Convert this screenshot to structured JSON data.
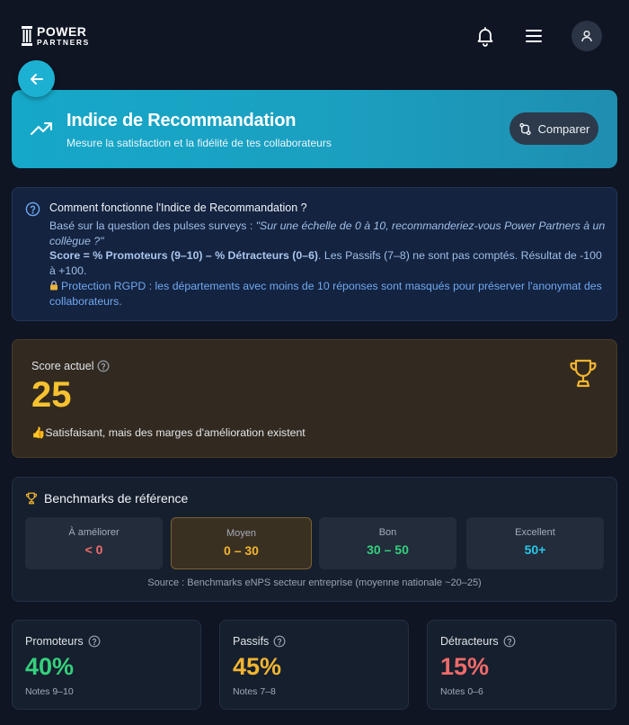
{
  "brand": {
    "line1": "POWER",
    "line2": "PARTNERS"
  },
  "header": {
    "icons": [
      "bell-icon",
      "menu-icon",
      "user-icon"
    ]
  },
  "hero": {
    "title": "Indice de Recommandation",
    "subtitle": "Mesure la satisfaction et la fidélité de tes collaborateurs",
    "compare_label": "Comparer"
  },
  "info": {
    "title": "Comment fonctionne l'Indice de Recommandation ?",
    "question_prefix": "Basé sur la question des pulses surveys : ",
    "question_text": "\"Sur une échelle de 0 à 10, recommanderiez-vous Power Partners à un collègue ?\"",
    "formula": "Score = % Promoteurs (9–10) – % Détracteurs (0–6)",
    "formula_note": ". Les Passifs (7–8) ne sont pas comptés. Résultat de -100 à +100.",
    "rgpd": "Protection RGPD : les départements avec moins de 10 réponses sont masqués pour préserver l'anonymat des collaborateurs."
  },
  "score": {
    "label": "Score actuel",
    "value": "25",
    "status": "Satisfaisant, mais des marges d'amélioration existent"
  },
  "benchmarks": {
    "title": "Benchmarks de référence",
    "tiers": [
      {
        "label": "À améliorer",
        "range": "< 0",
        "color": "#f06a6a"
      },
      {
        "label": "Moyen",
        "range": "0 – 30",
        "color": "#f2b531"
      },
      {
        "label": "Bon",
        "range": "30 – 50",
        "color": "#34d17c"
      },
      {
        "label": "Excellent",
        "range": "50+",
        "color": "#29c7e8"
      }
    ],
    "active_index": 1,
    "source": "Source : Benchmarks eNPS secteur entreprise (moyenne nationale ~20–25)"
  },
  "stats": [
    {
      "label": "Promoteurs",
      "value": "40%",
      "note": "Notes 9–10",
      "color": "#34d17c"
    },
    {
      "label": "Passifs",
      "value": "45%",
      "note": "Notes 7–8",
      "color": "#f2b531"
    },
    {
      "label": "Détracteurs",
      "value": "15%",
      "note": "Notes 0–6",
      "color": "#f06a6a"
    }
  ]
}
